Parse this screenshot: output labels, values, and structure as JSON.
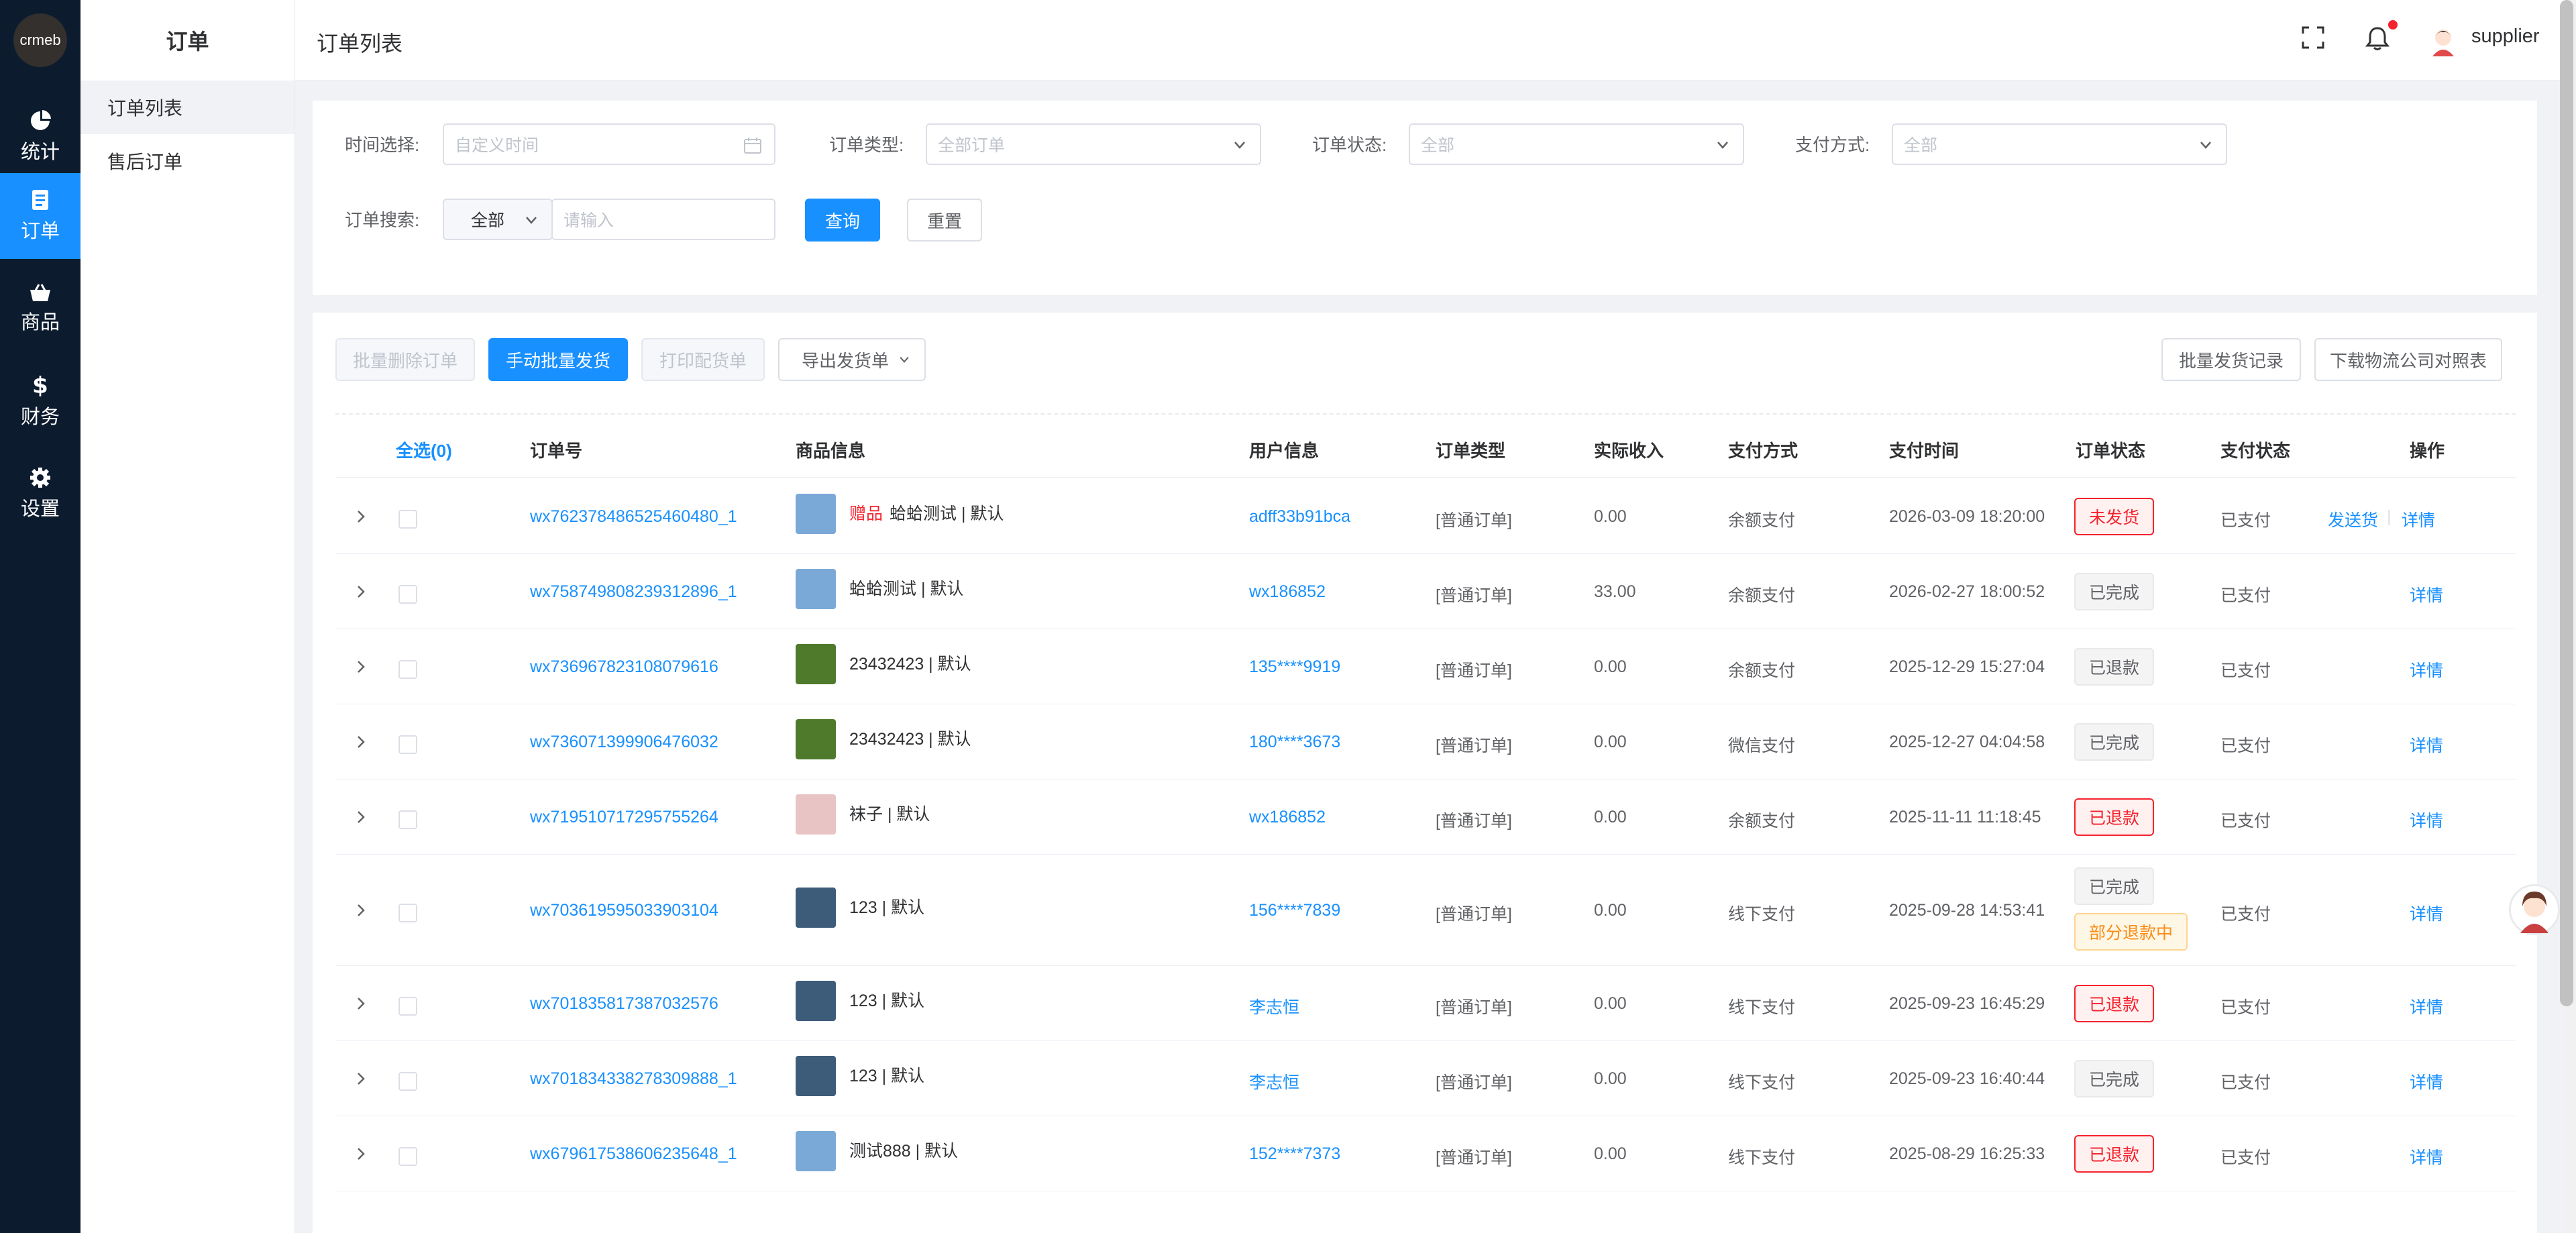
{
  "sidebar": {
    "logo": "crmeb",
    "items": [
      {
        "label": "统计",
        "icon": "pie-chart-icon"
      },
      {
        "label": "订单",
        "icon": "document-icon"
      },
      {
        "label": "商品",
        "icon": "basket-icon"
      },
      {
        "label": "财务",
        "icon": "dollar-icon"
      },
      {
        "label": "设置",
        "icon": "gear-icon"
      }
    ]
  },
  "submenu": {
    "title": "订单",
    "items": [
      {
        "label": "订单列表"
      },
      {
        "label": "售后订单"
      }
    ]
  },
  "header": {
    "title": "订单列表",
    "username": "supplier"
  },
  "filters": {
    "time_label": "时间选择:",
    "time_placeholder": "自定义时间",
    "type_label": "订单类型:",
    "type_placeholder": "全部订单",
    "status_label": "订单状态:",
    "status_placeholder": "全部",
    "pay_label": "支付方式:",
    "pay_placeholder": "全部",
    "search_label": "订单搜索:",
    "search_scope": "全部",
    "search_placeholder": "请输入",
    "query_button": "查询",
    "reset_button": "重置"
  },
  "toolbar": {
    "batch_delete": "批量删除订单",
    "batch_ship": "手动批量发货",
    "print": "打印配货单",
    "export": "导出发货单",
    "ship_records": "批量发货记录",
    "download_logistics": "下载物流公司对照表"
  },
  "table": {
    "select_all": "全选(0)",
    "columns": [
      "订单号",
      "商品信息",
      "用户信息",
      "订单类型",
      "实际收入",
      "支付方式",
      "支付时间",
      "订单状态",
      "支付状态",
      "操作"
    ],
    "rows": [
      {
        "order_no": "wx762378486525460480_1",
        "gift": "赠品",
        "product": "蛤蛤测试 | 默认",
        "user": "adff33b91bca",
        "type": "[普通订单]",
        "income": "0.00",
        "pay_method": "余额支付",
        "pay_time": "2026-03-09 18:20:00",
        "status": [
          "未发货"
        ],
        "pay_status": "已支付",
        "actions": [
          "发送货",
          "详情"
        ]
      },
      {
        "order_no": "wx758749808239312896_1",
        "gift": "",
        "product": "蛤蛤测试 | 默认",
        "user": "wx186852",
        "type": "[普通订单]",
        "income": "33.00",
        "pay_method": "余额支付",
        "pay_time": "2026-02-27 18:00:52",
        "status": [
          "已完成"
        ],
        "pay_status": "已支付",
        "actions": [
          "详情"
        ]
      },
      {
        "order_no": "wx736967823108079616",
        "gift": "",
        "product": "23432423 | 默认",
        "user": "135****9919",
        "type": "[普通订单]",
        "income": "0.00",
        "pay_method": "余额支付",
        "pay_time": "2025-12-29 15:27:04",
        "status": [
          "已退款"
        ],
        "pay_status": "已支付",
        "actions": [
          "详情"
        ]
      },
      {
        "order_no": "wx736071399906476032",
        "gift": "",
        "product": "23432423 | 默认",
        "user": "180****3673",
        "type": "[普通订单]",
        "income": "0.00",
        "pay_method": "微信支付",
        "pay_time": "2025-12-27 04:04:58",
        "status": [
          "已完成"
        ],
        "pay_status": "已支付",
        "actions": [
          "详情"
        ]
      },
      {
        "order_no": "wx719510717295755264",
        "gift": "",
        "product": "袜子 | 默认",
        "user": "wx186852",
        "type": "[普通订单]",
        "income": "0.00",
        "pay_method": "余额支付",
        "pay_time": "2025-11-11 11:18:45",
        "status": [
          "已退款"
        ],
        "pay_status": "已支付",
        "actions": [
          "详情"
        ]
      },
      {
        "order_no": "wx703619595033903104",
        "gift": "",
        "product": "123 | 默认",
        "user": "156****7839",
        "type": "[普通订单]",
        "income": "0.00",
        "pay_method": "线下支付",
        "pay_time": "2025-09-28 14:53:41",
        "status": [
          "已完成",
          "部分退款中"
        ],
        "pay_status": "已支付",
        "actions": [
          "详情"
        ]
      },
      {
        "order_no": "wx701835817387032576",
        "gift": "",
        "product": "123 | 默认",
        "user": "李志恒",
        "type": "[普通订单]",
        "income": "0.00",
        "pay_method": "线下支付",
        "pay_time": "2025-09-23 16:45:29",
        "status": [
          "已退款"
        ],
        "pay_status": "已支付",
        "actions": [
          "详情"
        ]
      },
      {
        "order_no": "wx701834338278309888_1",
        "gift": "",
        "product": "123 | 默认",
        "user": "李志恒",
        "type": "[普通订单]",
        "income": "0.00",
        "pay_method": "线下支付",
        "pay_time": "2025-09-23 16:40:44",
        "status": [
          "已完成"
        ],
        "pay_status": "已支付",
        "actions": [
          "详情"
        ]
      },
      {
        "order_no": "wx679617538606235648_1",
        "gift": "",
        "product": "测试888 | 默认",
        "user": "152****7373",
        "type": "[普通订单]",
        "income": "0.00",
        "pay_method": "线下支付",
        "pay_time": "2025-08-29 16:25:33",
        "status": [
          "已退款"
        ],
        "pay_status": "已支付",
        "actions": [
          "详情"
        ]
      }
    ]
  },
  "colors": {
    "primary": "#1890ff",
    "rail": "#0c1b2e",
    "danger": "#f5222d",
    "warning": "#fa8c16"
  }
}
